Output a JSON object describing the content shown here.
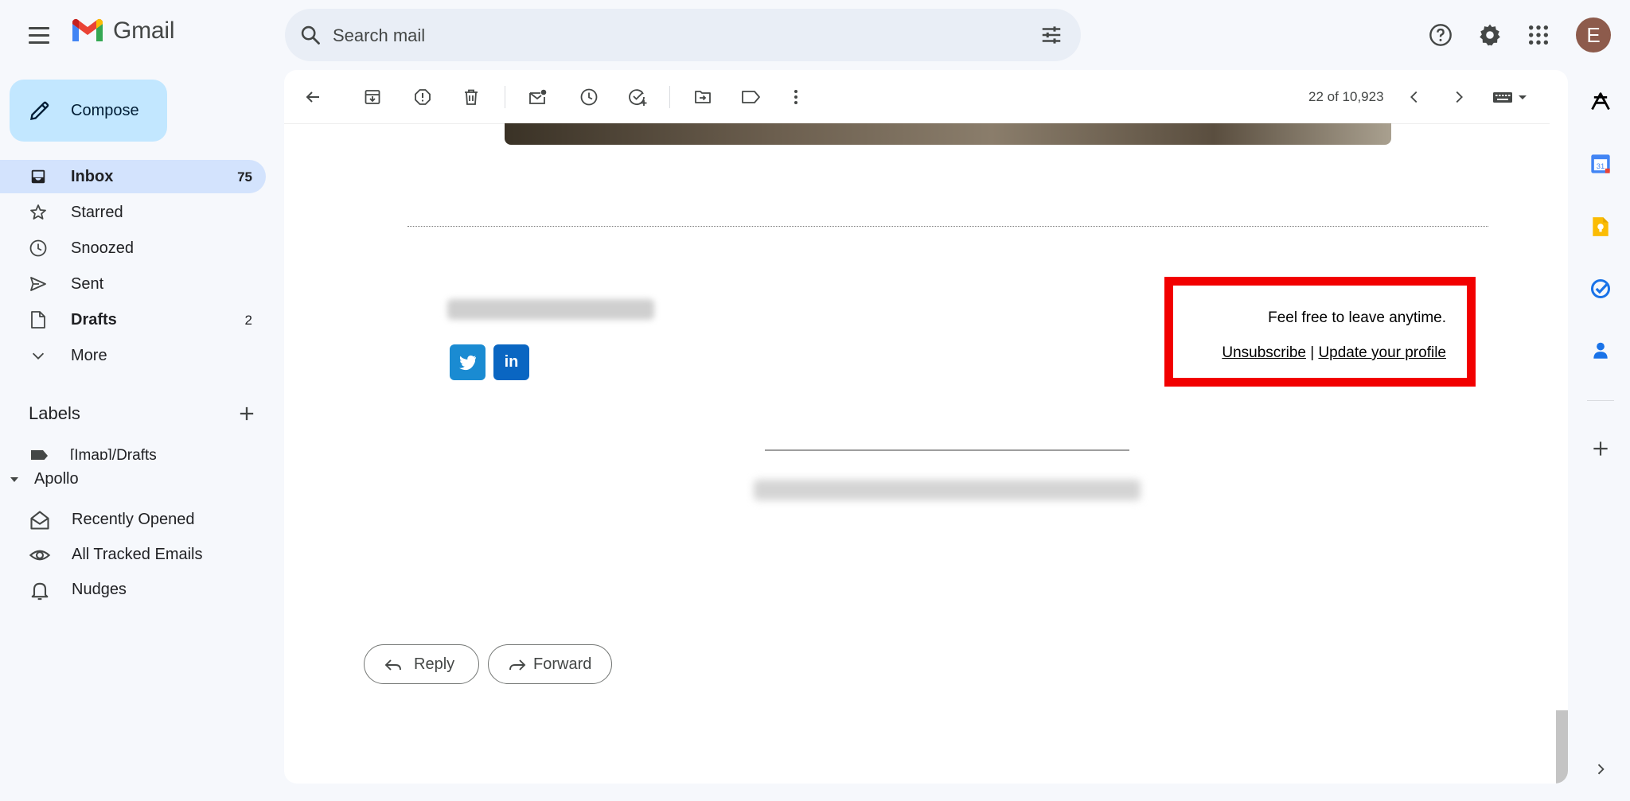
{
  "app": {
    "logo_text": "Gmail"
  },
  "search": {
    "placeholder": "Search mail"
  },
  "header": {
    "avatar_letter": "E"
  },
  "sidebar": {
    "compose_label": "Compose",
    "items": [
      {
        "label": "Inbox",
        "count": "75"
      },
      {
        "label": "Starred",
        "count": ""
      },
      {
        "label": "Snoozed",
        "count": ""
      },
      {
        "label": "Sent",
        "count": ""
      },
      {
        "label": "Drafts",
        "count": "2"
      },
      {
        "label": "More",
        "count": ""
      }
    ],
    "labels_header": "Labels",
    "label_items": [
      {
        "label": "[Imap]/Drafts"
      }
    ],
    "apollo": {
      "header": "Apollo",
      "items": [
        {
          "label": "Recently Opened"
        },
        {
          "label": "All Tracked Emails"
        },
        {
          "label": "Nudges"
        }
      ]
    }
  },
  "toolbar": {
    "page_count": "22 of 10,923"
  },
  "email": {
    "leave_text": "Feel free to leave anytime.",
    "unsubscribe": "Unsubscribe",
    "separator": "|",
    "update_profile": "Update your profile",
    "social": {
      "twitter": "twitter-icon",
      "linkedin": "in"
    }
  },
  "actions": {
    "reply": "Reply",
    "forward": "Forward"
  },
  "colors": {
    "highlight_box": "#f20000",
    "compose_bg": "#c2e7ff",
    "inbox_active": "#d3e3fd",
    "twitter": "#1a8bd2",
    "linkedin": "#0a66c2"
  }
}
